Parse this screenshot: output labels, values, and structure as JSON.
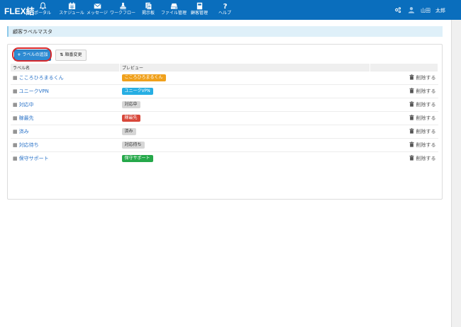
{
  "app": {
    "brand": "FLEX結"
  },
  "nav": {
    "items": [
      {
        "label": "ポータル",
        "icon": "bell-icon"
      },
      {
        "label": "スケジュール",
        "icon": "calendar-icon"
      },
      {
        "label": "メッセージ",
        "icon": "envelope-icon"
      },
      {
        "label": "ワークフロー",
        "icon": "stamp-icon"
      },
      {
        "label": "掲示板",
        "icon": "board-icon"
      },
      {
        "label": "ファイル管理",
        "icon": "drive-icon"
      },
      {
        "label": "顧客管理",
        "icon": "book-icon"
      },
      {
        "label": "ヘルプ",
        "icon": "question-icon"
      }
    ],
    "user": "山田　太郎"
  },
  "page": {
    "title": "顧客ラベルマスタ"
  },
  "toolbar": {
    "add_label": "ラベルの追加",
    "order_label": "順番変更"
  },
  "table": {
    "headers": [
      "ラベル名",
      "プレビュー",
      ""
    ],
    "delete_label": "削除する",
    "rows": [
      {
        "name": "こころひろまるくん",
        "preview": "こころひろまるくん",
        "color": "#f0a11c"
      },
      {
        "name": "ユニークVPN",
        "preview": "ユニークVPN",
        "color": "#27aee3"
      },
      {
        "name": "対応中",
        "preview": "対応中",
        "color": "#d6d6d6"
      },
      {
        "name": "稼最先",
        "preview": "稼最先",
        "color": "#d8473a"
      },
      {
        "name": "済み",
        "preview": "済み",
        "color": "#d6d6d6"
      },
      {
        "name": "対応待ち",
        "preview": "対応待ち",
        "color": "#d6d6d6"
      },
      {
        "name": "保守サポート",
        "preview": "保守サポート",
        "color": "#25a84a"
      }
    ]
  },
  "colors": {
    "nav_bg": "#0a6ebd",
    "primary_button": "#2e8bd2",
    "highlight": "#d8282a"
  }
}
